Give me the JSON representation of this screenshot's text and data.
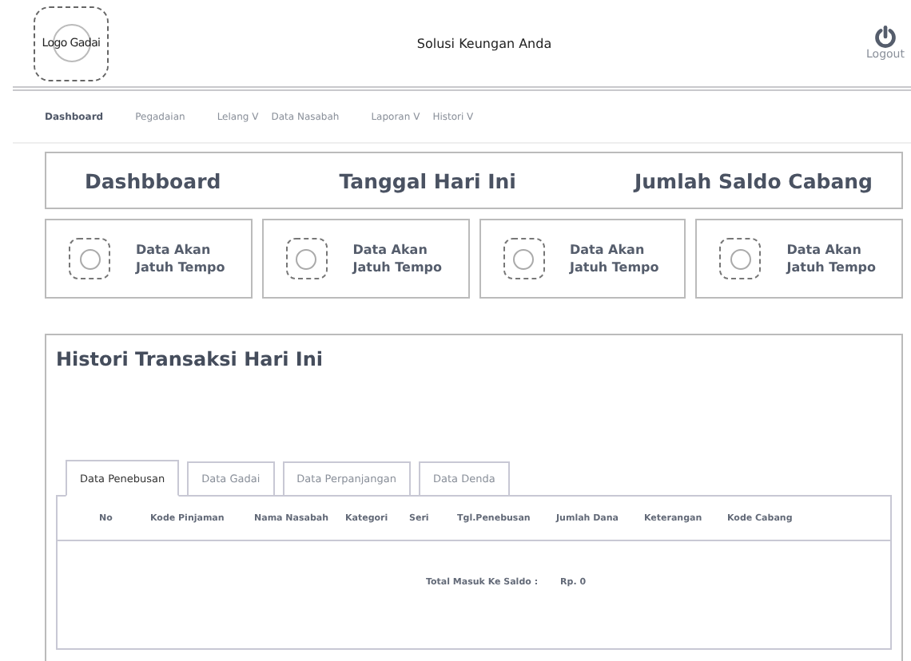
{
  "header": {
    "logo": "Logo Gadai",
    "title": "Solusi Keungan Anda",
    "logout": "Logout"
  },
  "nav": [
    {
      "label": "Dashboard",
      "selected": true
    },
    {
      "label": "Pegadaian",
      "selected": false
    },
    {
      "label": "Lelang V",
      "selected": false
    },
    {
      "label": "Data Nasabah",
      "selected": false
    },
    {
      "label": "Laporan V",
      "selected": false
    },
    {
      "label": "Histori V",
      "selected": false
    }
  ],
  "summary": [
    "Dashbboard",
    "Tanggal Hari Ini",
    "Jumlah Saldo Cabang"
  ],
  "cards": [
    {
      "lines": [
        "Data Akan",
        "Jatuh Tempo"
      ]
    },
    {
      "lines": [
        "Data Akan",
        "Jatuh Tempo"
      ]
    },
    {
      "lines": [
        "Data Akan",
        "Jatuh Tempo"
      ]
    },
    {
      "lines": [
        "Data Akan",
        "Jatuh Tempo"
      ]
    }
  ],
  "history": {
    "title": "Histori Transaksi Hari Ini",
    "tabs": [
      {
        "label": "Data Penebusan",
        "selected": true
      },
      {
        "label": "Data Gadai",
        "selected": false
      },
      {
        "label": "Data Perpanjangan",
        "selected": false
      },
      {
        "label": "Data Denda",
        "selected": false
      }
    ],
    "columns": [
      "No",
      "Kode Pinjaman",
      "Nama Nasabah",
      "Kategori",
      "Seri",
      "Tgl.Penebusan",
      "Jumlah Dana",
      "Keterangan",
      "Kode Cabang"
    ],
    "total_label": "Total Masuk Ke Saldo :",
    "total_value": "Rp. 0"
  }
}
